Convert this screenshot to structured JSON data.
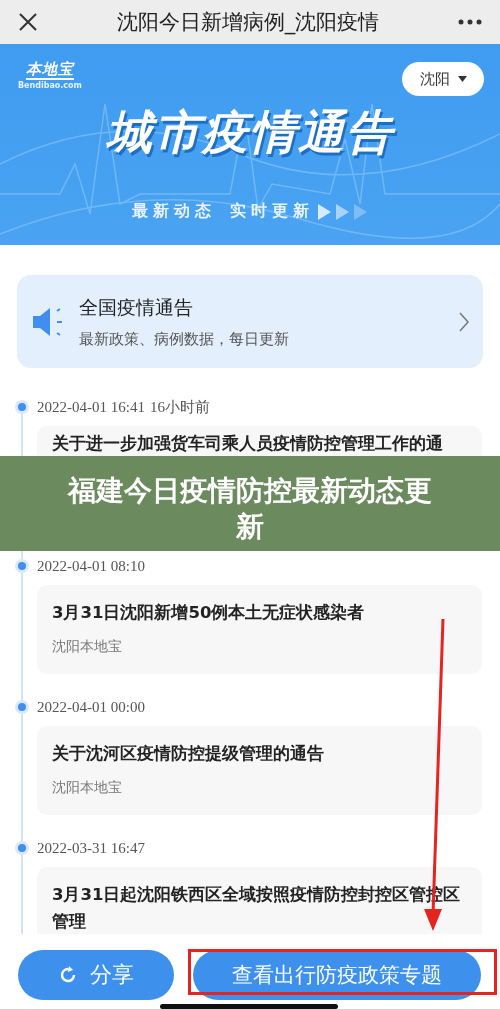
{
  "top_bar": {
    "title": "沈阳今日新增病例_沈阳疫情"
  },
  "hero": {
    "logo_text": "本地宝",
    "logo_subtext": "Bendibao.com",
    "city": "沈阳",
    "title": "城市疫情通告",
    "subtitle": [
      "最新动态",
      "实时更新"
    ]
  },
  "notice": {
    "title": "全国疫情通告",
    "subtitle": "最新政策、病例数据，每日更新"
  },
  "timeline": [
    {
      "date": "2022-04-01 16:41",
      "relative": "16小时前",
      "title": "关于进一步加强货车司乘人员疫情防控管理工作的通"
    },
    {
      "date": "2022-04-01 08:10",
      "title": "3月31日沈阳新增50例本土无症状感染者",
      "source": "沈阳本地宝"
    },
    {
      "date": "2022-04-01 00:00",
      "title": "关于沈河区疫情防控提级管理的通告",
      "source": "沈阳本地宝"
    },
    {
      "date": "2022-03-31 16:47",
      "title": "3月31日起沈阳铁西区全域按照疫情防控封控区管控区管理"
    }
  ],
  "buttons": [
    {
      "kind": "share",
      "label": "分享",
      "annotated": false
    },
    {
      "kind": "primary",
      "label": "查看出行防疫政策专题",
      "annotated": true
    }
  ],
  "caption": "福建今日疫情防控最新动态更新"
}
